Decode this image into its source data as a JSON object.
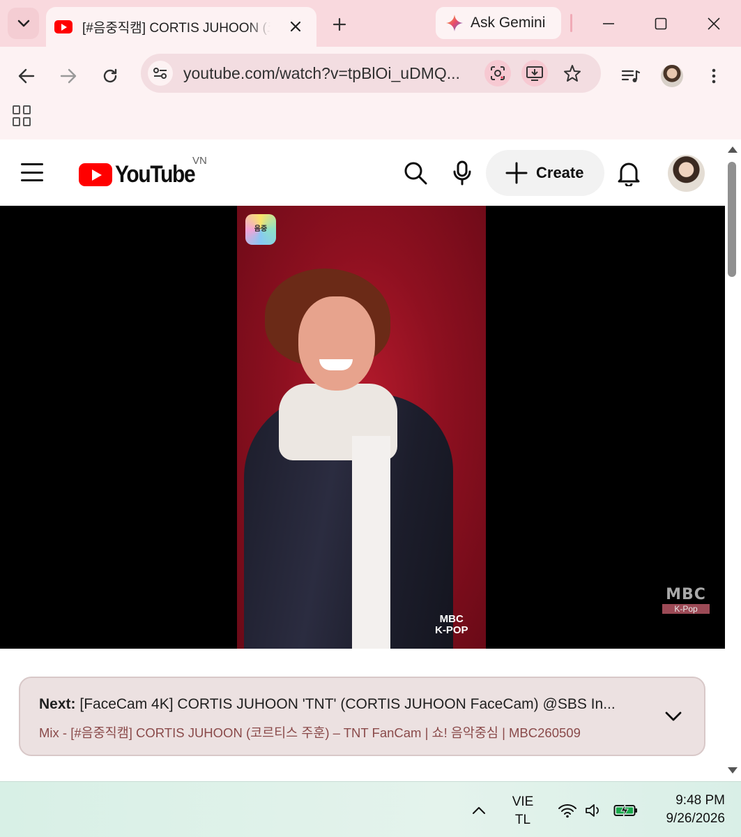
{
  "browser": {
    "tab_title": "[#음중직캠] CORTIS JUHOON (코르티스 주훈)",
    "gemini_label": "Ask Gemini",
    "url": "youtube.com/watch?v=tpBlOi_uDMQ..."
  },
  "youtube": {
    "logo_text": "YouTube",
    "region": "VN",
    "create_label": "Create",
    "video_watermarks": {
      "corner_badge": "음중",
      "kpop_top": "MBC",
      "kpop_bottom": "K-POP",
      "mbc_top": "MBC",
      "mbc_bottom": "K-Pop"
    },
    "next": {
      "prefix": "Next:",
      "title": "[FaceCam 4K] CORTIS JUHOON 'TNT' (CORTIS JUHOON FaceCam) @SBS In...",
      "mix": "Mix - [#음중직캠] CORTIS JUHOON (코르티스 주훈) – TNT FanCam | 쇼! 음악중심 | MBC260509"
    }
  },
  "taskbar": {
    "lang_line1": "VIE",
    "lang_line2": "TL",
    "time": "9:48 PM",
    "date": "9/26/2026"
  },
  "icons": [
    "tab-search-icon",
    "youtube-favicon",
    "close-icon",
    "plus-icon",
    "gemini-icon",
    "minimize-icon",
    "maximize-icon",
    "back-icon",
    "forward-icon",
    "reload-icon",
    "site-settings-icon",
    "lens-icon",
    "install-icon",
    "star-icon",
    "media-icon",
    "menu-icon",
    "apps-icon",
    "search-icon",
    "mic-icon",
    "bell-icon",
    "chevron-down-icon",
    "chevron-up-icon",
    "wifi-icon",
    "volume-icon",
    "battery-icon"
  ]
}
